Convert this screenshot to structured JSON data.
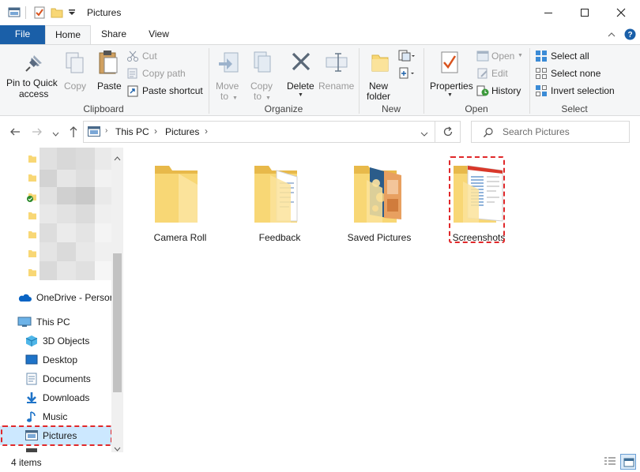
{
  "window": {
    "title": "Pictures",
    "qat": [
      "window-icon",
      "properties-check-icon",
      "new-folder-icon",
      "chevron-down-icon"
    ]
  },
  "tabs": [
    {
      "label": "File",
      "active": false
    },
    {
      "label": "Home",
      "active": true
    },
    {
      "label": "Share",
      "active": false
    },
    {
      "label": "View",
      "active": false
    }
  ],
  "ribbon": {
    "clipboard": {
      "group_label": "Clipboard",
      "pin_label1": "Pin to Quick",
      "pin_label2": "access",
      "copy_label": "Copy",
      "paste_label": "Paste",
      "cut_label": "Cut",
      "copy_path_label": "Copy path",
      "paste_shortcut_label": "Paste shortcut"
    },
    "organize": {
      "group_label": "Organize",
      "move_label1": "Move",
      "move_label2": "to",
      "copyto_label1": "Copy",
      "copyto_label2": "to",
      "delete_label": "Delete",
      "rename_label": "Rename"
    },
    "new": {
      "group_label": "New",
      "new_folder_label1": "New",
      "new_folder_label2": "folder"
    },
    "open": {
      "group_label": "Open",
      "properties_label": "Properties",
      "open_label": "Open",
      "edit_label": "Edit",
      "history_label": "History"
    },
    "select": {
      "group_label": "Select",
      "select_all_label": "Select all",
      "select_none_label": "Select none",
      "invert_label": "Invert selection"
    }
  },
  "address": {
    "crumbs": [
      "This PC",
      "Pictures"
    ],
    "search_placeholder": "Search Pictures"
  },
  "nav": {
    "onedrive": "OneDrive - Persor",
    "this_pc": "This PC",
    "items": [
      {
        "label": "3D Objects",
        "icon": "3d-objects-icon"
      },
      {
        "label": "Desktop",
        "icon": "desktop-icon"
      },
      {
        "label": "Documents",
        "icon": "documents-icon"
      },
      {
        "label": "Downloads",
        "icon": "downloads-icon"
      },
      {
        "label": "Music",
        "icon": "music-icon"
      },
      {
        "label": "Pictures",
        "icon": "pictures-icon",
        "selected": true
      }
    ]
  },
  "folders": [
    {
      "name": "Camera Roll"
    },
    {
      "name": "Feedback"
    },
    {
      "name": "Saved Pictures"
    },
    {
      "name": "Screenshots",
      "highlighted": true
    }
  ],
  "status": {
    "count": "4 items"
  },
  "colors": {
    "accent": "#1a5fa8",
    "folder": "#f8d775",
    "highlight": "#e0282a",
    "selected_bg": "#cce8ff"
  }
}
